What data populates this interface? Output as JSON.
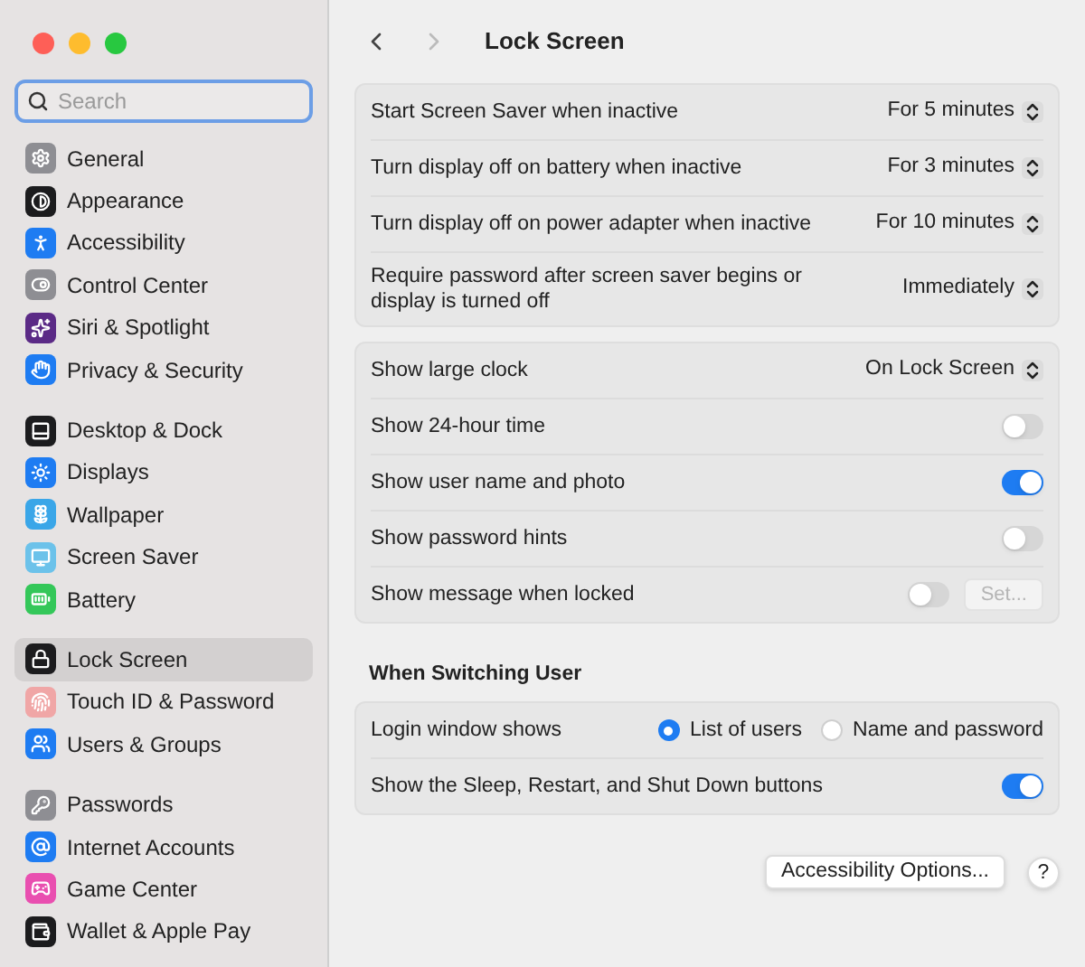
{
  "sidebar": {
    "search": {
      "placeholder": "Search"
    },
    "groups": [
      {
        "items": [
          {
            "label": "General",
            "color": "#8e8e93",
            "selected": false
          },
          {
            "label": "Appearance",
            "color": "#1c1c1e",
            "selected": false
          },
          {
            "label": "Accessibility",
            "color": "#1e7cf2",
            "selected": false
          },
          {
            "label": "Control Center",
            "color": "#8e8e93",
            "selected": false
          },
          {
            "label": "Siri & Spotlight",
            "color": "#5b2a86",
            "selected": false
          },
          {
            "label": "Privacy & Security",
            "color": "#1e7cf2",
            "selected": false
          }
        ]
      },
      {
        "items": [
          {
            "label": "Desktop & Dock",
            "color": "#1c1c1e",
            "selected": false
          },
          {
            "label": "Displays",
            "color": "#1e7cf2",
            "selected": false
          },
          {
            "label": "Wallpaper",
            "color": "#3aa6e8",
            "selected": false
          },
          {
            "label": "Screen Saver",
            "color": "#6cc2ea",
            "selected": false
          },
          {
            "label": "Battery",
            "color": "#34c759",
            "selected": false
          }
        ]
      },
      {
        "items": [
          {
            "label": "Lock Screen",
            "color": "#1c1c1e",
            "selected": true
          },
          {
            "label": "Touch ID & Password",
            "color": "#f0a6a6",
            "selected": false
          },
          {
            "label": "Users & Groups",
            "color": "#1e7cf2",
            "selected": false
          }
        ]
      },
      {
        "items": [
          {
            "label": "Passwords",
            "color": "#8e8e93",
            "selected": false
          },
          {
            "label": "Internet Accounts",
            "color": "#1e7cf2",
            "selected": false
          },
          {
            "label": "Game Center",
            "color": "#e94fb0",
            "selected": false
          },
          {
            "label": "Wallet & Apple Pay",
            "color": "#1c1c1e",
            "selected": false
          }
        ]
      }
    ]
  },
  "header": {
    "title": "Lock Screen",
    "back_enabled": true,
    "forward_enabled": false
  },
  "sections": [
    {
      "rows": [
        {
          "kind": "select",
          "label": "Start Screen Saver when inactive",
          "value": "For 5 minutes"
        },
        {
          "kind": "select",
          "label": "Turn display off on battery when inactive",
          "value": "For 3 minutes"
        },
        {
          "kind": "select",
          "label": "Turn display off on power adapter when inactive",
          "value": "For 10 minutes"
        },
        {
          "kind": "select",
          "label": "Require password after screen saver begins or display is turned off",
          "value": "Immediately"
        }
      ]
    },
    {
      "rows": [
        {
          "kind": "select",
          "label": "Show large clock",
          "value": "On Lock Screen"
        },
        {
          "kind": "toggle",
          "label": "Show 24-hour time",
          "on": false
        },
        {
          "kind": "toggle",
          "label": "Show user name and photo",
          "on": true
        },
        {
          "kind": "toggle",
          "label": "Show password hints",
          "on": false
        },
        {
          "kind": "toggle_button",
          "label": "Show message when locked",
          "on": false,
          "button": "Set...",
          "button_disabled": true
        }
      ]
    },
    {
      "title": "When Switching User",
      "rows": [
        {
          "kind": "radio",
          "label": "Login window shows",
          "options": [
            {
              "label": "List of users",
              "selected": true
            },
            {
              "label": "Name and password",
              "selected": false
            }
          ]
        },
        {
          "kind": "toggle",
          "label": "Show the Sleep, Restart, and Shut Down buttons",
          "on": true
        }
      ]
    }
  ],
  "footer": {
    "button": "Accessibility Options...",
    "help": "?"
  }
}
